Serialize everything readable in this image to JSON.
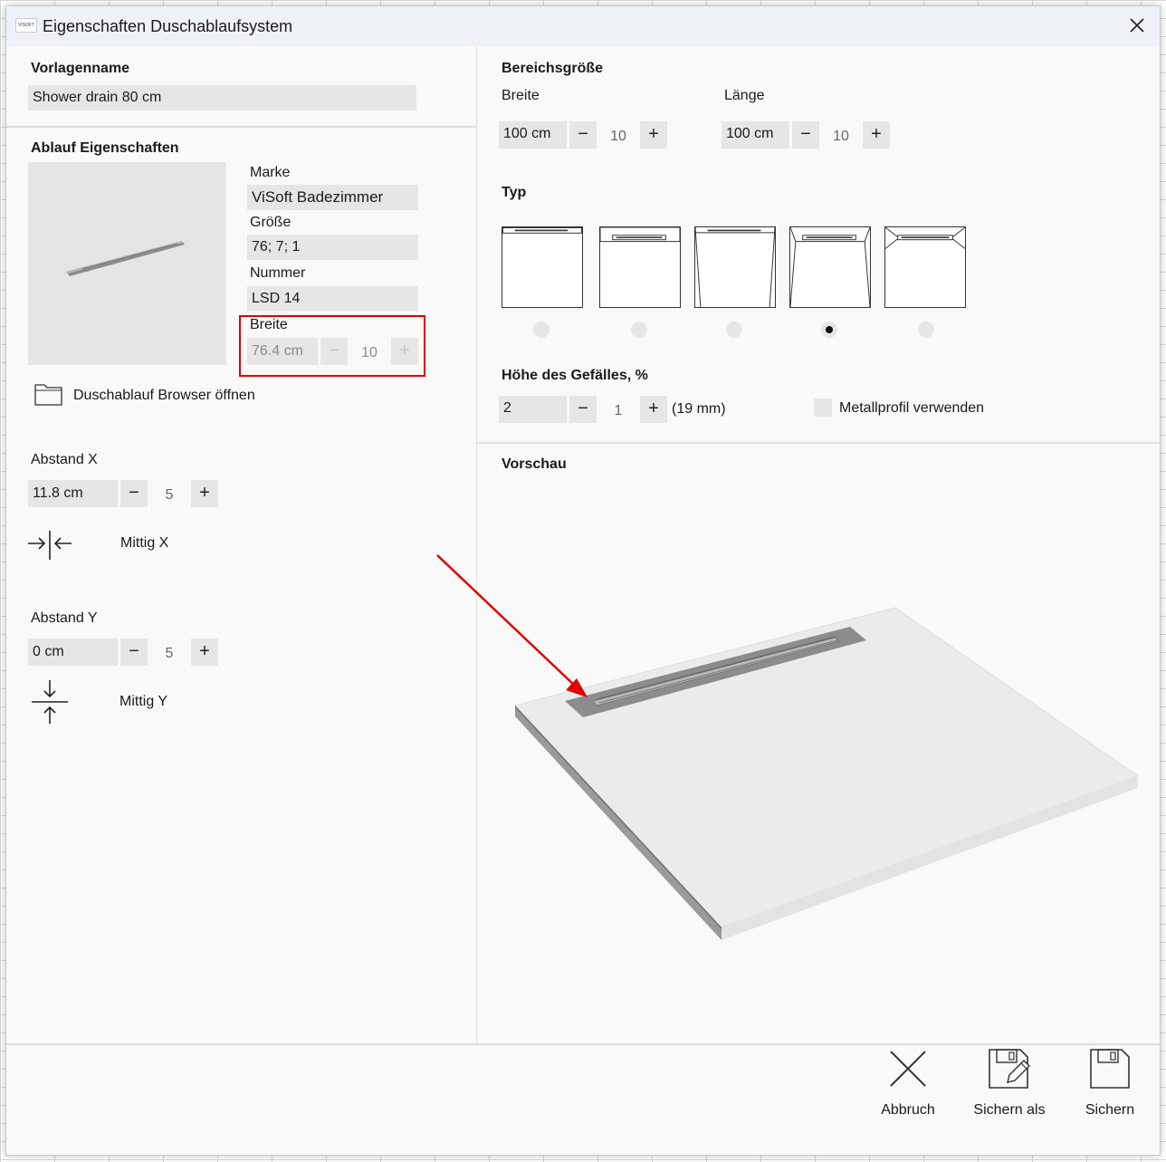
{
  "window": {
    "logo_text": "VISOFT",
    "title": "Eigenschaften Duschablaufsystem"
  },
  "template": {
    "heading": "Vorlagenname",
    "value": "Shower drain  80 cm"
  },
  "drain": {
    "heading": "Ablauf Eigenschaften",
    "brand_label": "Marke",
    "brand_value": "ViSoft Badezimmer",
    "size_label": "Größe",
    "size_value": "76; 7; 1",
    "number_label": "Nummer",
    "number_value": "LSD 14",
    "width_label": "Breite",
    "width_value": "76.4 cm",
    "width_step": "10",
    "browser_label": "Duschablauf Browser öffnen"
  },
  "offset_x": {
    "label": "Abstand X",
    "value": "11.8 cm",
    "step": "5",
    "center_label": "Mittig X"
  },
  "offset_y": {
    "label": "Abstand Y",
    "value": "0 cm",
    "step": "5",
    "center_label": "Mittig Y"
  },
  "area": {
    "heading": "Bereichsgröße",
    "width_label": "Breite",
    "width_value": "100 cm",
    "width_step": "10",
    "length_label": "Länge",
    "length_value": "100 cm",
    "length_step": "10"
  },
  "type": {
    "heading": "Typ",
    "options": [
      "type-1",
      "type-2",
      "type-3",
      "type-4",
      "type-5"
    ],
    "selected_index": 3
  },
  "slope": {
    "heading": "Höhe des Gefälles, %",
    "value": "2",
    "step": "1",
    "unit_note": "(19 mm)",
    "metal_profile_label": "Metallprofil verwenden",
    "metal_profile_checked": false
  },
  "preview": {
    "heading": "Vorschau"
  },
  "footer": {
    "cancel": "Abbruch",
    "save_as": "Sichern als",
    "save": "Sichern"
  },
  "symbols": {
    "minus": "−",
    "plus": "+"
  },
  "colors": {
    "highlight": "#e00000",
    "arrow": "#e00000",
    "field_bg": "#e6e6e6"
  }
}
